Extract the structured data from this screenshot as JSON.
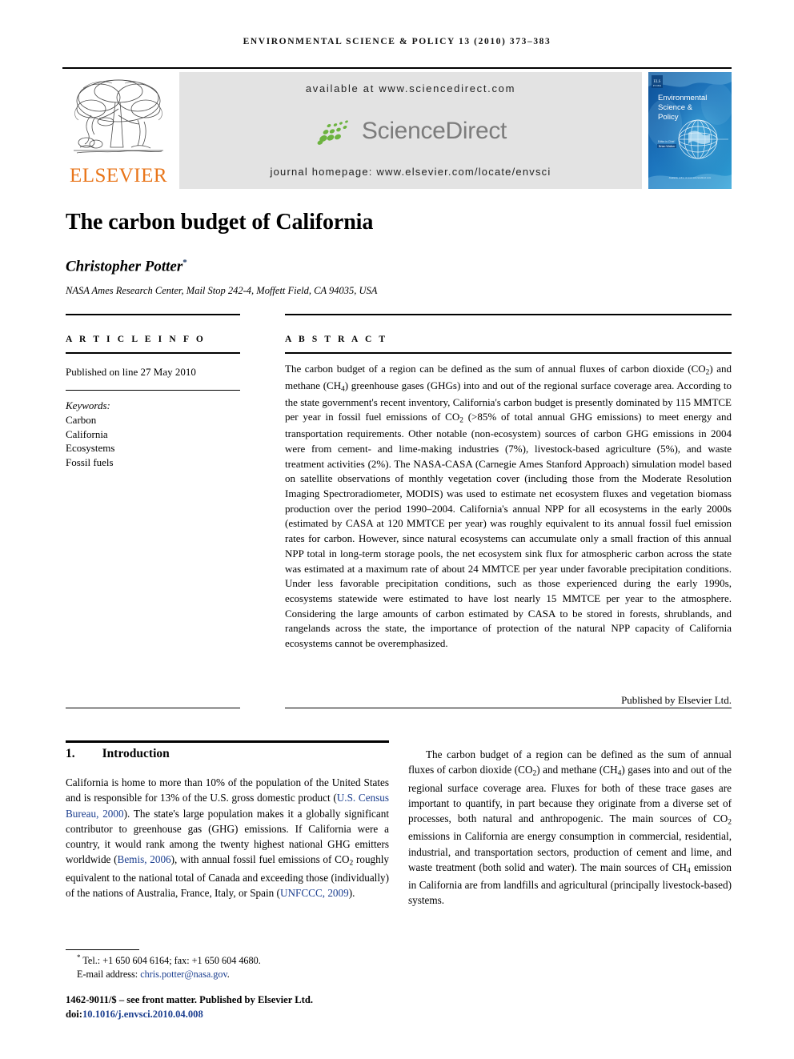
{
  "running_head": "ENVIRONMENTAL SCIENCE & POLICY 13 (2010) 373–383",
  "masthead": {
    "publisher_name": "ELSEVIER",
    "available_at": "available at www.sciencedirect.com",
    "sciencedirect_label": "ScienceDirect",
    "journal_homepage": "journal homepage: www.elsevier.com/locate/envsci",
    "cover": {
      "line1": "Environmental",
      "line2": "Science &",
      "line3": "Policy",
      "editor_line": "Editor-in-Chief",
      "editor_name": "Brian Walker",
      "footer_note": "Available online at www.sciencedirect.com"
    },
    "colors": {
      "elsevier_orange": "#E8751A",
      "banner_gray": "#e3e3e3",
      "sciencedirect_green": "#5aaa46",
      "sciencedirect_text_gray": "#7c7c7c",
      "cover_blue": "#1d6fb8"
    }
  },
  "article": {
    "title": "The carbon budget of California",
    "author": "Christopher Potter",
    "author_mark": "*",
    "affiliation": "NASA Ames Research Center, Mail Stop 242-4, Moffett Field, CA 94035, USA"
  },
  "article_info": {
    "heading": "A R T I C L E   I N F O",
    "published": "Published on line 27 May 2010",
    "keywords_heading": "Keywords:",
    "keywords": [
      "Carbon",
      "California",
      "Ecosystems",
      "Fossil fuels"
    ]
  },
  "abstract": {
    "heading": "A B S T R A C T",
    "paragraphs": [
      "The carbon budget of a region can be defined as the sum of annual fluxes of carbon dioxide (CO2) and methane (CH4) greenhouse gases (GHGs) into and out of the regional surface coverage area. According to the state government's recent inventory, California's carbon budget is presently dominated by 115 MMTCE per year in fossil fuel emissions of CO2 (>85% of total annual GHG emissions) to meet energy and transportation requirements. Other notable (non-ecosystem) sources of carbon GHG emissions in 2004 were from cement- and lime-making industries (7%), livestock-based agriculture (5%), and waste treatment activities (2%). The NASA-CASA (Carnegie Ames Stanford Approach) simulation model based on satellite observations of monthly vegetation cover (including those from the Moderate Resolution Imaging Spectroradiometer, MODIS) was used to estimate net ecosystem fluxes and vegetation biomass production over the period 1990–2004. California's annual NPP for all ecosystems in the early 2000s (estimated by CASA at 120 MMTCE per year) was roughly equivalent to its annual fossil fuel emission rates for carbon. However, since natural ecosystems can accumulate only a small fraction of this annual NPP total in long-term storage pools, the net ecosystem sink flux for atmospheric carbon across the state was estimated at a maximum rate of about 24 MMTCE per year under favorable precipitation conditions. Under less favorable precipitation conditions, such as those experienced during the early 1990s, ecosystems statewide were estimated to have lost nearly 15 MMTCE per year to the atmosphere. Considering the large amounts of carbon estimated by CASA to be stored in forests, shrublands, and rangelands across the state, the importance of protection of the natural NPP capacity of California ecosystems cannot be overemphasized."
    ],
    "signature": "Published by Elsevier Ltd."
  },
  "body": {
    "section_number": "1.",
    "section_title": "Introduction",
    "left_paragraph_html": "California is home to more than 10% of the population of the United States and is responsible for 13% of the U.S. gross domestic product (<span class=\"cite\">U.S. Census Bureau, 2000</span>). The state's large population makes it a globally significant contributor to greenhouse gas (GHG) emissions. If California were a country, it would rank among the twenty highest national GHG emitters worldwide (<span class=\"cite\">Bemis, 2006</span>), with annual fossil fuel emissions of CO<sub>2</sub> roughly equivalent to the national total of Canada and exceeding those (individually) of the nations of Australia, France, Italy, or Spain (<span class=\"cite\">UNFCCC, 2009</span>).",
    "right_paragraph_html": "The carbon budget of a region can be defined as the sum of annual fluxes of carbon dioxide (CO<sub>2</sub>) and methane (CH<sub>4</sub>) gases into and out of the regional surface coverage area. Fluxes for both of these trace gases are important to quantify, in part because they originate from a diverse set of processes, both natural and anthropogenic. The main sources of CO<sub>2</sub> emissions in California are energy consumption in commercial, residential, industrial, and transportation sectors, production of cement and lime, and waste treatment (both solid and water). The main sources of CH<sub>4</sub> emission in California are from landfills and agricultural (principally livestock-based) systems."
  },
  "footnotes": {
    "tel_fax": "Tel.: +1 650 604 6164; fax: +1 650 604 4680.",
    "email_label": "E-mail address:",
    "email": "chris.potter@nasa.gov",
    "issn_line": "1462-9011/$ – see front matter. Published by Elsevier Ltd.",
    "doi_label": "doi:",
    "doi": "10.1016/j.envsci.2010.04.008"
  }
}
